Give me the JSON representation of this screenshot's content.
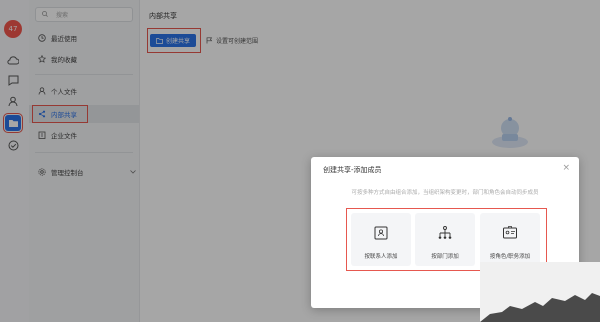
{
  "rail": {
    "badge": "47"
  },
  "sidebar": {
    "search_placeholder": "搜索",
    "items": [
      {
        "label": "最近使用"
      },
      {
        "label": "我的收藏"
      },
      {
        "label": "个人文件"
      },
      {
        "label": "内部共享"
      },
      {
        "label": "企业文件"
      },
      {
        "label": "管理控制台"
      }
    ]
  },
  "main": {
    "title": "内部共享",
    "create_button": "创建共享",
    "settings_button": "设置可创建范围"
  },
  "dialog": {
    "title": "创建共享-添加成员",
    "close": "×",
    "hint": "可按多种方式自由组合添加，当组织架构变更时，部门和角色会自动同步成员",
    "options": [
      {
        "label": "按联系人添加"
      },
      {
        "label": "按部门添加"
      },
      {
        "label": "按角色/职务添加"
      }
    ]
  },
  "colors": {
    "accent": "#2b73e8",
    "highlight": "#e6584f",
    "badge": "#f2574e"
  }
}
